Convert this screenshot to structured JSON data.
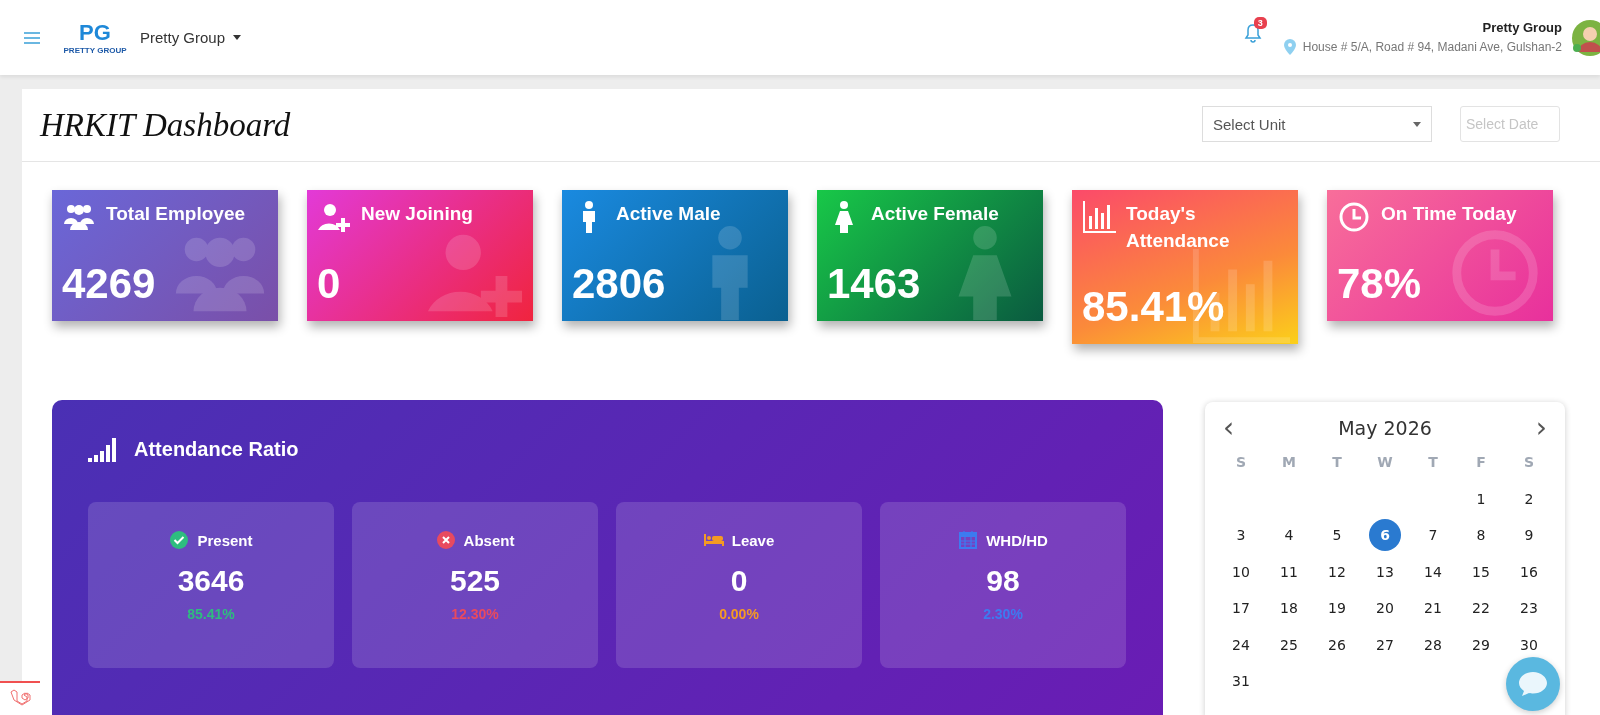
{
  "header": {
    "logo": {
      "letters": "PG",
      "caption": "PRETTY GROUP"
    },
    "company_menu": "Pretty Group",
    "notifications": {
      "count": "3"
    },
    "user": {
      "name": "Pretty Group",
      "address": "House # 5/A, Road # 94, Madani Ave, Gulshan-2",
      "online": true
    }
  },
  "page": {
    "title": "HRKIT Dashboard",
    "unit_select": {
      "placeholder": "Select Unit"
    },
    "date_field": {
      "placeholder": "Select Date"
    }
  },
  "cards": [
    {
      "kind": "group",
      "title": "Total Employee",
      "value": "4269"
    },
    {
      "kind": "add-user",
      "title": "New Joining",
      "value": "0"
    },
    {
      "kind": "male",
      "title": "Active Male",
      "value": "2806"
    },
    {
      "kind": "female",
      "title": "Active Female",
      "value": "1463"
    },
    {
      "kind": "chart",
      "title": "Today's Attendance",
      "value": "85.41%"
    },
    {
      "kind": "clock",
      "title": "On Time Today",
      "value": "78%"
    }
  ],
  "attendance": {
    "title": "Attendance Ratio",
    "stats": [
      {
        "kind": "check",
        "label": "Present",
        "value": "3646",
        "percent": "85.41%",
        "color": "#2ebd7f"
      },
      {
        "kind": "cross",
        "label": "Absent",
        "value": "525",
        "percent": "12.30%",
        "color": "#e84a5f"
      },
      {
        "kind": "bed",
        "label": "Leave",
        "value": "0",
        "percent": "0.00%",
        "color": "#f59a23"
      },
      {
        "kind": "calendar",
        "label": "WHD/HD",
        "value": "98",
        "percent": "2.30%",
        "color": "#3d7bf0"
      }
    ]
  },
  "calendar": {
    "prev": "‹",
    "month": "May 2026",
    "next": "›",
    "weekdays": [
      "S",
      "M",
      "T",
      "W",
      "T",
      "F",
      "S"
    ],
    "weeks": [
      [
        {
          "day": "1",
          "selected": false
        },
        {
          "day": "2",
          "selected": false
        }
      ],
      [
        {
          "day": "3",
          "selected": false
        },
        {
          "day": "4",
          "selected": false
        },
        {
          "day": "5",
          "selected": false
        },
        {
          "day": "6",
          "selected": true
        },
        {
          "day": "7",
          "selected": false
        },
        {
          "day": "8",
          "selected": false
        },
        {
          "day": "9",
          "selected": false
        }
      ],
      [
        {
          "day": "10",
          "selected": false
        },
        {
          "day": "11",
          "selected": false
        },
        {
          "day": "12",
          "selected": false
        },
        {
          "day": "13",
          "selected": false
        },
        {
          "day": "14",
          "selected": false
        },
        {
          "day": "15",
          "selected": false
        },
        {
          "day": "16",
          "selected": false
        }
      ],
      [
        {
          "day": "17",
          "selected": false
        },
        {
          "day": "18",
          "selected": false
        },
        {
          "day": "19",
          "selected": false
        },
        {
          "day": "20",
          "selected": false
        },
        {
          "day": "21",
          "selected": false
        },
        {
          "day": "22",
          "selected": false
        },
        {
          "day": "23",
          "selected": false
        }
      ],
      [
        {
          "day": "24",
          "selected": false
        },
        {
          "day": "25",
          "selected": false
        },
        {
          "day": "26",
          "selected": false
        },
        {
          "day": "27",
          "selected": false
        },
        {
          "day": "28",
          "selected": false
        },
        {
          "day": "29",
          "selected": false
        },
        {
          "day": "30",
          "selected": false
        }
      ],
      [
        {
          "day": "31",
          "selected": false
        }
      ]
    ]
  }
}
